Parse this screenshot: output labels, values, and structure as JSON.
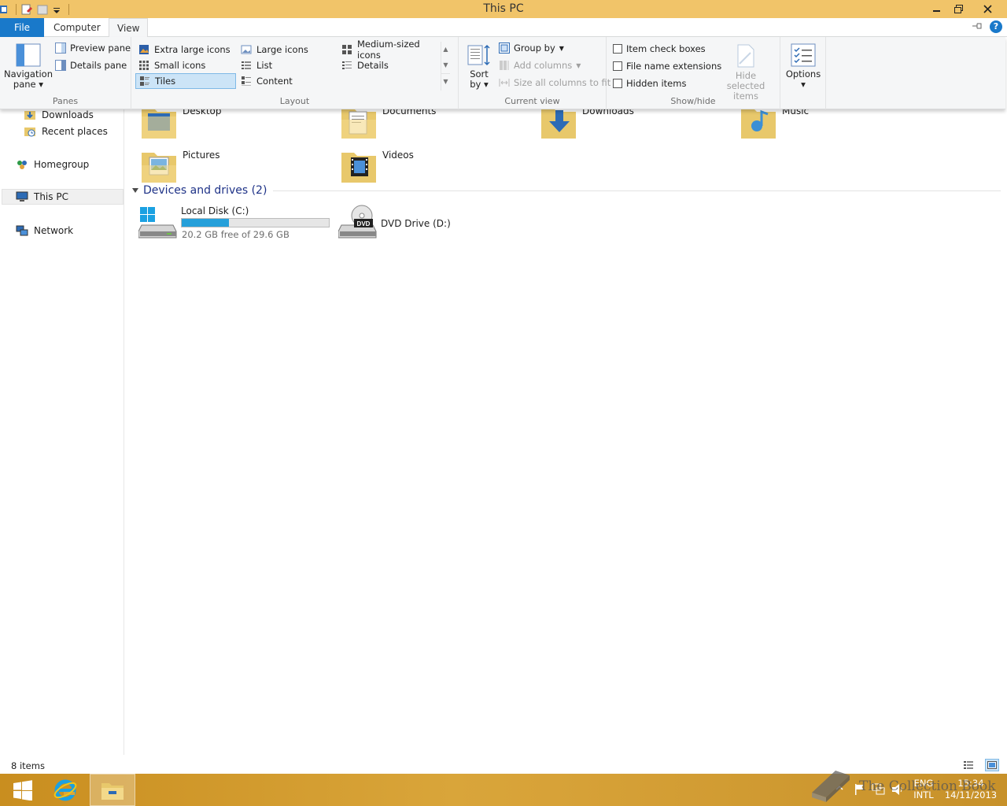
{
  "window": {
    "title": "This PC"
  },
  "ribbon_tabs": {
    "file": "File",
    "computer": "Computer",
    "view": "View"
  },
  "panes_group": {
    "navigation_pane_line1": "Navigation",
    "navigation_pane_line2": "pane",
    "preview_pane": "Preview pane",
    "details_pane": "Details pane",
    "label": "Panes"
  },
  "layout_group": {
    "items": [
      "Extra large icons",
      "Large icons",
      "Medium-sized icons",
      "Small icons",
      "List",
      "Details",
      "Tiles",
      "Content"
    ],
    "selected": "Tiles",
    "label": "Layout"
  },
  "current_view_group": {
    "sort_line1": "Sort",
    "sort_line2": "by",
    "group_by": "Group by",
    "add_columns": "Add columns",
    "size_columns": "Size all columns to fit",
    "label": "Current view"
  },
  "show_hide_group": {
    "item_check_boxes": "Item check boxes",
    "file_name_extensions": "File name extensions",
    "hidden_items": "Hidden items",
    "hide_selected_line1": "Hide selected",
    "hide_selected_line2": "items",
    "label": "Show/hide"
  },
  "options": {
    "label": "Options"
  },
  "nav_pane": {
    "downloads": "Downloads",
    "recent_places": "Recent places",
    "homegroup": "Homegroup",
    "this_pc": "This PC",
    "network": "Network"
  },
  "folders": [
    "Desktop",
    "Documents",
    "Downloads",
    "Music",
    "Pictures",
    "Videos"
  ],
  "devices_section": {
    "title": "Devices and drives (2)"
  },
  "drives": {
    "c_name": "Local Disk (C:)",
    "c_free": "20.2 GB free of 29.6 GB",
    "c_used_fraction": 0.32,
    "d_name": "DVD Drive (D:)",
    "dvd_badge": "DVD"
  },
  "status": {
    "items": "8 items"
  },
  "tray": {
    "lang1": "ENG",
    "lang2": "INTL",
    "time": "15:34",
    "date": "14/11/2013"
  },
  "watermark": "The Collection Book",
  "colors": {
    "accent": "#1979ca",
    "titlebar": "#f1c469",
    "drive_fill": "#26a0da"
  }
}
